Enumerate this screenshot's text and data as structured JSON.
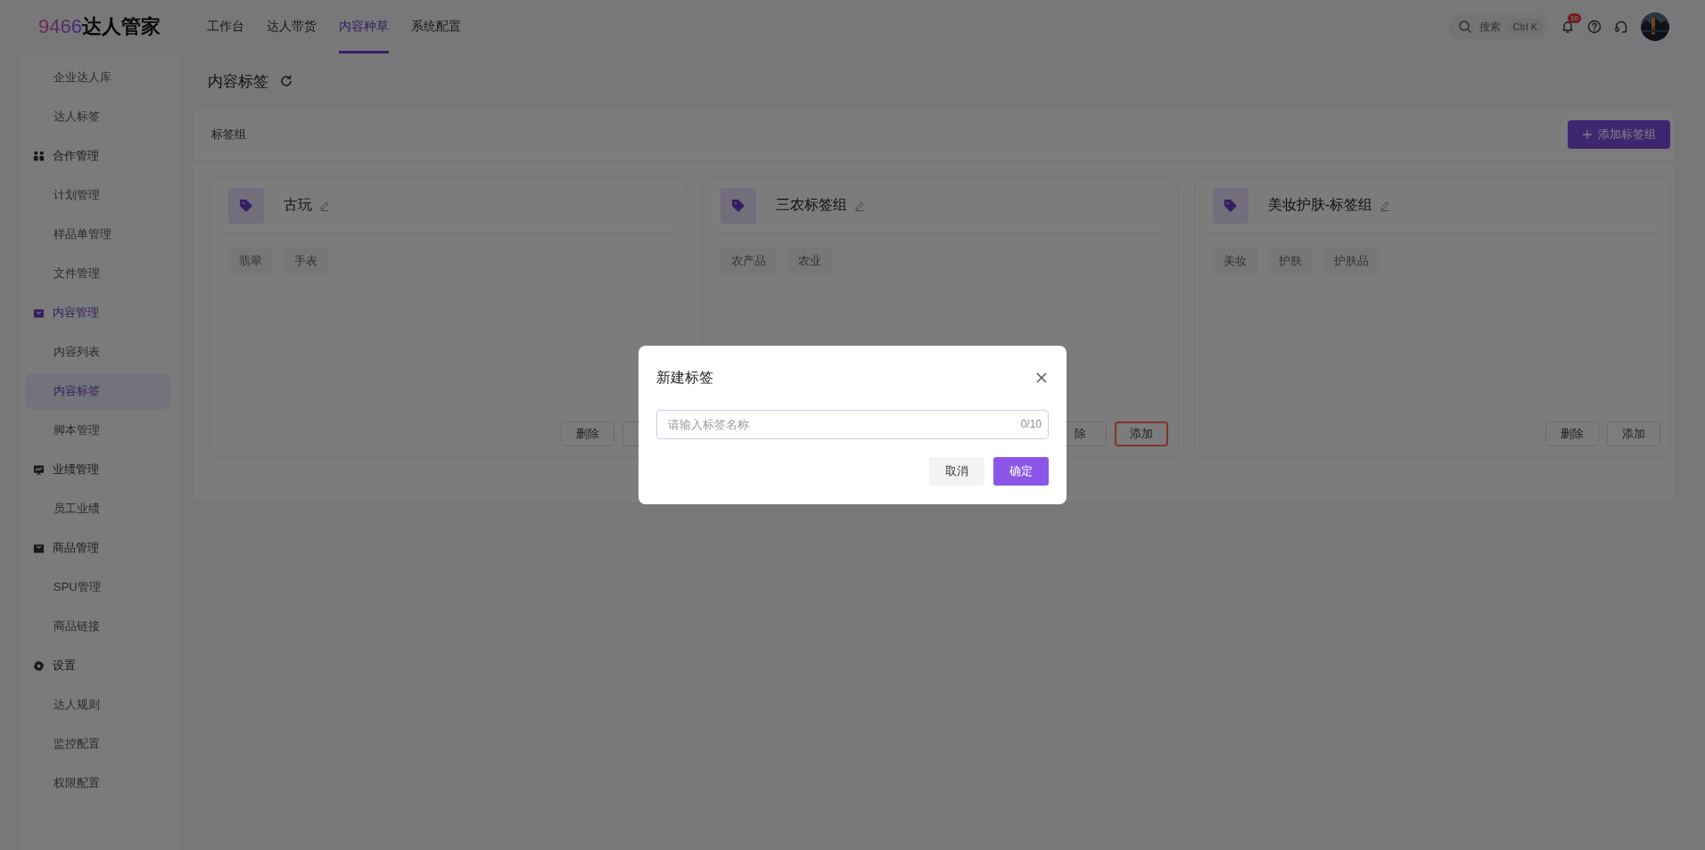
{
  "logo": {
    "number": "9466",
    "name": "达人管家"
  },
  "nav": [
    {
      "label": "工作台",
      "selected": false
    },
    {
      "label": "达人带货",
      "selected": false
    },
    {
      "label": "内容种草",
      "selected": true
    },
    {
      "label": "系统配置",
      "selected": false
    }
  ],
  "header": {
    "search_label": "搜索",
    "shortcut": "Ctrl K",
    "notification_count": "10"
  },
  "sidebar": {
    "groups": [
      {
        "children": [
          {
            "label": "企业达人库",
            "selected": false
          },
          {
            "label": "达人标签",
            "selected": false
          }
        ]
      },
      {
        "label": "合作管理",
        "active": false,
        "children": [
          {
            "label": "计划管理",
            "selected": false
          },
          {
            "label": "样品单管理",
            "selected": false
          },
          {
            "label": "文件管理",
            "selected": false
          }
        ]
      },
      {
        "label": "内容管理",
        "active": true,
        "children": [
          {
            "label": "内容列表",
            "selected": false
          },
          {
            "label": "内容标签",
            "selected": true
          },
          {
            "label": "脚本管理",
            "selected": false
          }
        ]
      },
      {
        "label": "业绩管理",
        "active": false,
        "children": [
          {
            "label": "员工业绩",
            "selected": false
          }
        ]
      },
      {
        "label": "商品管理",
        "active": false,
        "children": [
          {
            "label": "SPU管理",
            "selected": false
          },
          {
            "label": "商品链接",
            "selected": false
          }
        ]
      },
      {
        "label": "设置",
        "active": false,
        "children": [
          {
            "label": "达人规则",
            "selected": false
          },
          {
            "label": "监控配置",
            "selected": false
          },
          {
            "label": "权限配置",
            "selected": false
          }
        ]
      }
    ]
  },
  "page": {
    "title": "内容标签"
  },
  "panel": {
    "title": "标签组",
    "add_button": "添加标签组",
    "cards": [
      {
        "title": "古玩",
        "tags": [
          "翡翠",
          "手表"
        ],
        "buttons": [
          {
            "label": "删除",
            "highlighted": false
          },
          {
            "highlighted": false
          }
        ]
      },
      {
        "title": "三农标签组",
        "tags": [
          "农产品",
          "农业"
        ],
        "buttons": [
          {
            "label": "除",
            "highlighted": false
          },
          {
            "label": "添加",
            "highlighted": true
          }
        ]
      },
      {
        "title": "美妆护肤-标签组",
        "tags": [
          "美妆",
          "护肤",
          "护肤品"
        ],
        "buttons": [
          {
            "label": "删除",
            "highlighted": false
          },
          {
            "label": "添加",
            "highlighted": false
          }
        ]
      }
    ]
  },
  "dialog": {
    "title": "新建标签",
    "input": {
      "placeholder": "请输入标签名称",
      "counter": "0/10"
    },
    "buttons": [
      {
        "label": "取消",
        "kind": "secondary"
      },
      {
        "label": "确定",
        "kind": "primary"
      }
    ]
  }
}
